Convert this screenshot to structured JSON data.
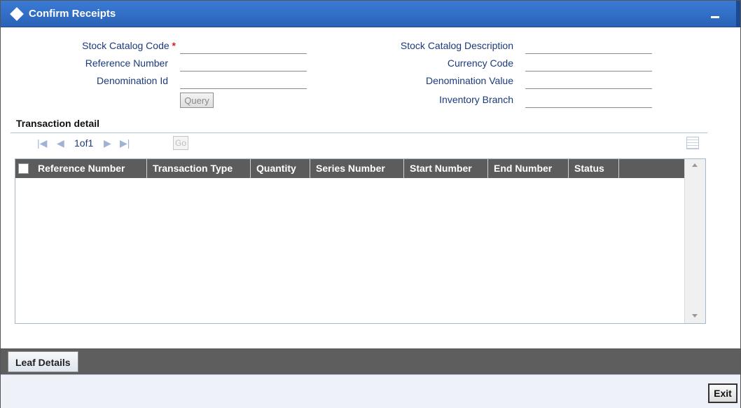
{
  "window": {
    "title": "Confirm Receipts",
    "minimize_label": "_"
  },
  "form": {
    "stock_catalog_code": {
      "label": "Stock Catalog Code",
      "required_mark": "*",
      "value": ""
    },
    "reference_number": {
      "label": "Reference Number",
      "value": ""
    },
    "denomination_id": {
      "label": "Denomination Id",
      "value": ""
    },
    "stock_catalog_description": {
      "label": "Stock Catalog Description",
      "value": ""
    },
    "currency_code": {
      "label": "Currency Code",
      "value": ""
    },
    "denomination_value": {
      "label": "Denomination Value",
      "value": ""
    },
    "inventory_branch": {
      "label": "Inventory Branch",
      "value": ""
    },
    "query_label": "Query"
  },
  "transaction_detail": {
    "title": "Transaction detail",
    "pager": {
      "page_text": "1of1",
      "go_label": "Go"
    },
    "columns": [
      "Reference Number",
      "Transaction Type",
      "Quantity",
      "Series Number",
      "Start Number",
      "End Number",
      "Status"
    ],
    "rows": []
  },
  "tabs": {
    "leaf_details": "Leaf Details"
  },
  "footer": {
    "exit_label": "Exit"
  },
  "icons": {
    "title": "diamond-icon",
    "first": "first-page-icon",
    "prev": "prev-page-icon",
    "next": "next-page-icon",
    "last": "last-page-icon",
    "grid": "grid-view-icon"
  },
  "colors": {
    "titlebar": "#2a63b8",
    "label": "#1a3a7a",
    "table_header": "#5c5c5c",
    "bottom_band": "#5e5e5e",
    "required": "#d42020"
  }
}
